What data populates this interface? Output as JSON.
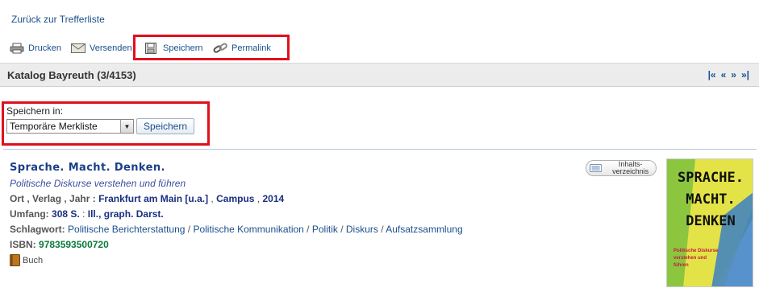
{
  "nav": {
    "back_label": "Zurück zur Trefferliste"
  },
  "toolbar": {
    "print_label": "Drucken",
    "send_label": "Versenden",
    "save_label": "Speichern",
    "permalink_label": "Permalink"
  },
  "catalog": {
    "title": "Katalog Bayreuth (3/4153)",
    "pager": [
      "|«",
      "«",
      "»",
      "»|"
    ]
  },
  "save_form": {
    "label": "Speichern in:",
    "selected_option": "Temporäre Merkliste",
    "button_label": "Speichern"
  },
  "record": {
    "title": "Sprache. Macht. Denken.",
    "subtitle": "Politische Diskurse verstehen und führen",
    "pub_key": "Ort , Verlag , Jahr :",
    "place": "Frankfurt am Main [u.a.]",
    "publisher": "Campus",
    "year": "2014",
    "sep": ",",
    "extent_key": "Umfang:",
    "extent_pages": "308 S.",
    "extent_colon": " : ",
    "extent_ill": "Ill., graph. Darst.",
    "subject_key": "Schlagwort:",
    "subjects": [
      "Politische Berichterstattung",
      "Politische Kommunikation",
      "Politik",
      "Diskurs",
      "Aufsatzsammlung"
    ],
    "subject_sep": " / ",
    "isbn_key": "ISBN:",
    "isbn": "9783593500720",
    "media_type": "Buch",
    "toc_label": "Inhalts-verzeichnis"
  },
  "cover": {
    "words": [
      "SPRACHE.",
      "MACHT.",
      "DENKEN"
    ],
    "tagline": "Politische Diskurse verstehen und führen",
    "colors": {
      "green": "#8cc63f",
      "yellow": "#f2e84a",
      "blue": "#3b7fc4"
    }
  },
  "highlight_color": "#e0101e"
}
